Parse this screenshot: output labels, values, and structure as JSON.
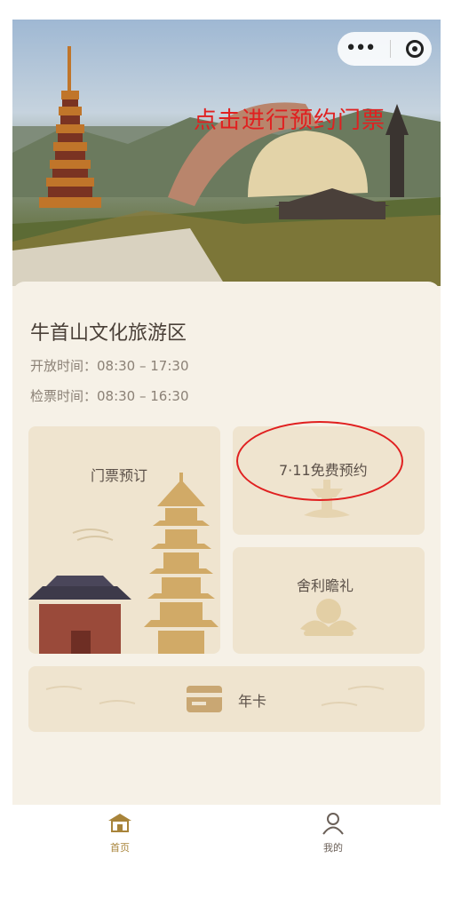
{
  "capsule": {
    "more_icon": "more-dots-icon",
    "close_icon": "target-circle-icon"
  },
  "scenic": {
    "title": "牛首山文化旅游区",
    "open_hours": "开放时间：08:30 – 17:30",
    "check_hours": "检票时间：08:30 – 16:30"
  },
  "annotation": {
    "text": "点击进行预约门票",
    "color": "#e02020"
  },
  "tiles": {
    "ticket": "门票预订",
    "free": "7·11免费预约",
    "relic": "舍利瞻礼",
    "annual": "年卡"
  },
  "tabbar": {
    "home": "首页",
    "mine": "我的"
  },
  "colors": {
    "accent": "#a8843a",
    "tile": "#efe4cf",
    "bg": "#f6f1e7"
  }
}
